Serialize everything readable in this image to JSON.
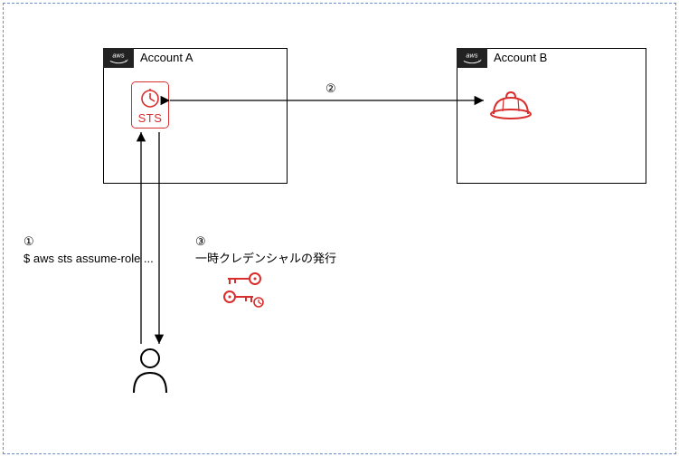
{
  "accountA": {
    "label": "Account A",
    "sts_label": "STS"
  },
  "accountB": {
    "label": "Account B"
  },
  "step1": {
    "num": "①",
    "text": "$ aws sts assume-role ..."
  },
  "step2": {
    "num": "②"
  },
  "step3": {
    "num": "③",
    "text": "一時クレデンシャルの発行"
  },
  "icons": {
    "aws": "aws",
    "sts": "sts-icon",
    "role_hat": "iam-role-icon",
    "user": "user-icon",
    "credentials": "temporary-credentials-icon"
  }
}
